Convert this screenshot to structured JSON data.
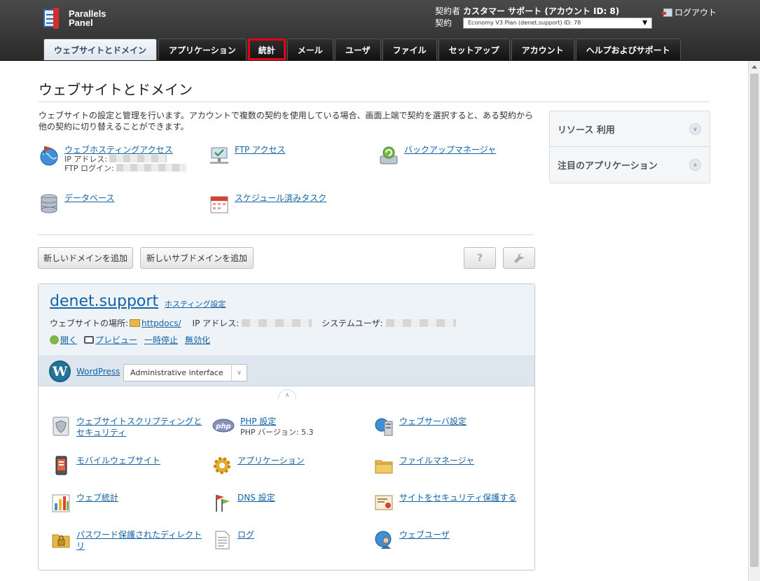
{
  "header": {
    "logo_line1": "Parallels",
    "logo_line2": "Panel",
    "account_label": "契約者",
    "account_name": "カスタマー サポート (アカウント ID: 8)",
    "subscription_label": "契約",
    "subscription_value": "Economy V3 Plan (denet.support) ID: 78",
    "logout": "ログアウト"
  },
  "tabs": [
    {
      "label": "ウェブサイトとドメイン"
    },
    {
      "label": "アプリケーション"
    },
    {
      "label": "統計"
    },
    {
      "label": "メール"
    },
    {
      "label": "ユーザ"
    },
    {
      "label": "ファイル"
    },
    {
      "label": "セットアップ"
    },
    {
      "label": "アカウント"
    },
    {
      "label": "ヘルプおよびサポート"
    }
  ],
  "page": {
    "title": "ウェブサイトとドメイン",
    "intro": "ウェブサイトの設定と管理を行います。アカウントで複数の契約を使用している場合、画面上端で契約を選択すると、ある契約から他の契約に切り替えることができます。"
  },
  "quick_links": {
    "hosting_access": "ウェブホスティングアクセス",
    "ip_label": "IP アドレス:",
    "ftp_login_label": "FTP ログイン:",
    "ftp_access": "FTP アクセス",
    "backup": "バックアップマネージャ",
    "database": "データベース",
    "scheduled": "スケジュール済みタスク"
  },
  "buttons": {
    "add_domain": "新しいドメインを追加",
    "add_subdomain": "新しいサブドメインを追加",
    "help": "?"
  },
  "domain": {
    "name": "denet.support",
    "hosting_settings": "ホスティング設定",
    "site_location_label": "ウェブサイトの場所:",
    "site_location": "httpdocs/",
    "ip_label": "IP アドレス:",
    "sysuser_label": "システムユーザ:",
    "actions": [
      "開く",
      "プレビュー",
      "一時停止",
      "無効化"
    ],
    "wp_name": "WordPress",
    "wp_select": "Administrative interface"
  },
  "tools": {
    "scripting_1": "ウェブサイトスクリプティングと",
    "scripting_2": "セキュリティ",
    "php": "PHP 設定",
    "php_version": "PHP バージョン: 5.3",
    "webserver": "ウェブサーバ設定",
    "mobile": "モバイルウェブサイト",
    "applications": "アプリケーション",
    "file_manager": "ファイルマネージャ",
    "web_stats": "ウェブ統計",
    "dns": "DNS 設定",
    "secure": "サイトをセキュリティ保護する",
    "pwdir_1": "パスワード保護されたディレクト",
    "pwdir_2": "リ",
    "logs": "ログ",
    "web_users": "ウェブユーザ",
    "php_badge": "php"
  },
  "side": {
    "resource": "リソース 利用",
    "featured_apps": "注目のアプリケーション"
  },
  "colors": {
    "highlight": "#e60012",
    "link": "#1463a6"
  }
}
